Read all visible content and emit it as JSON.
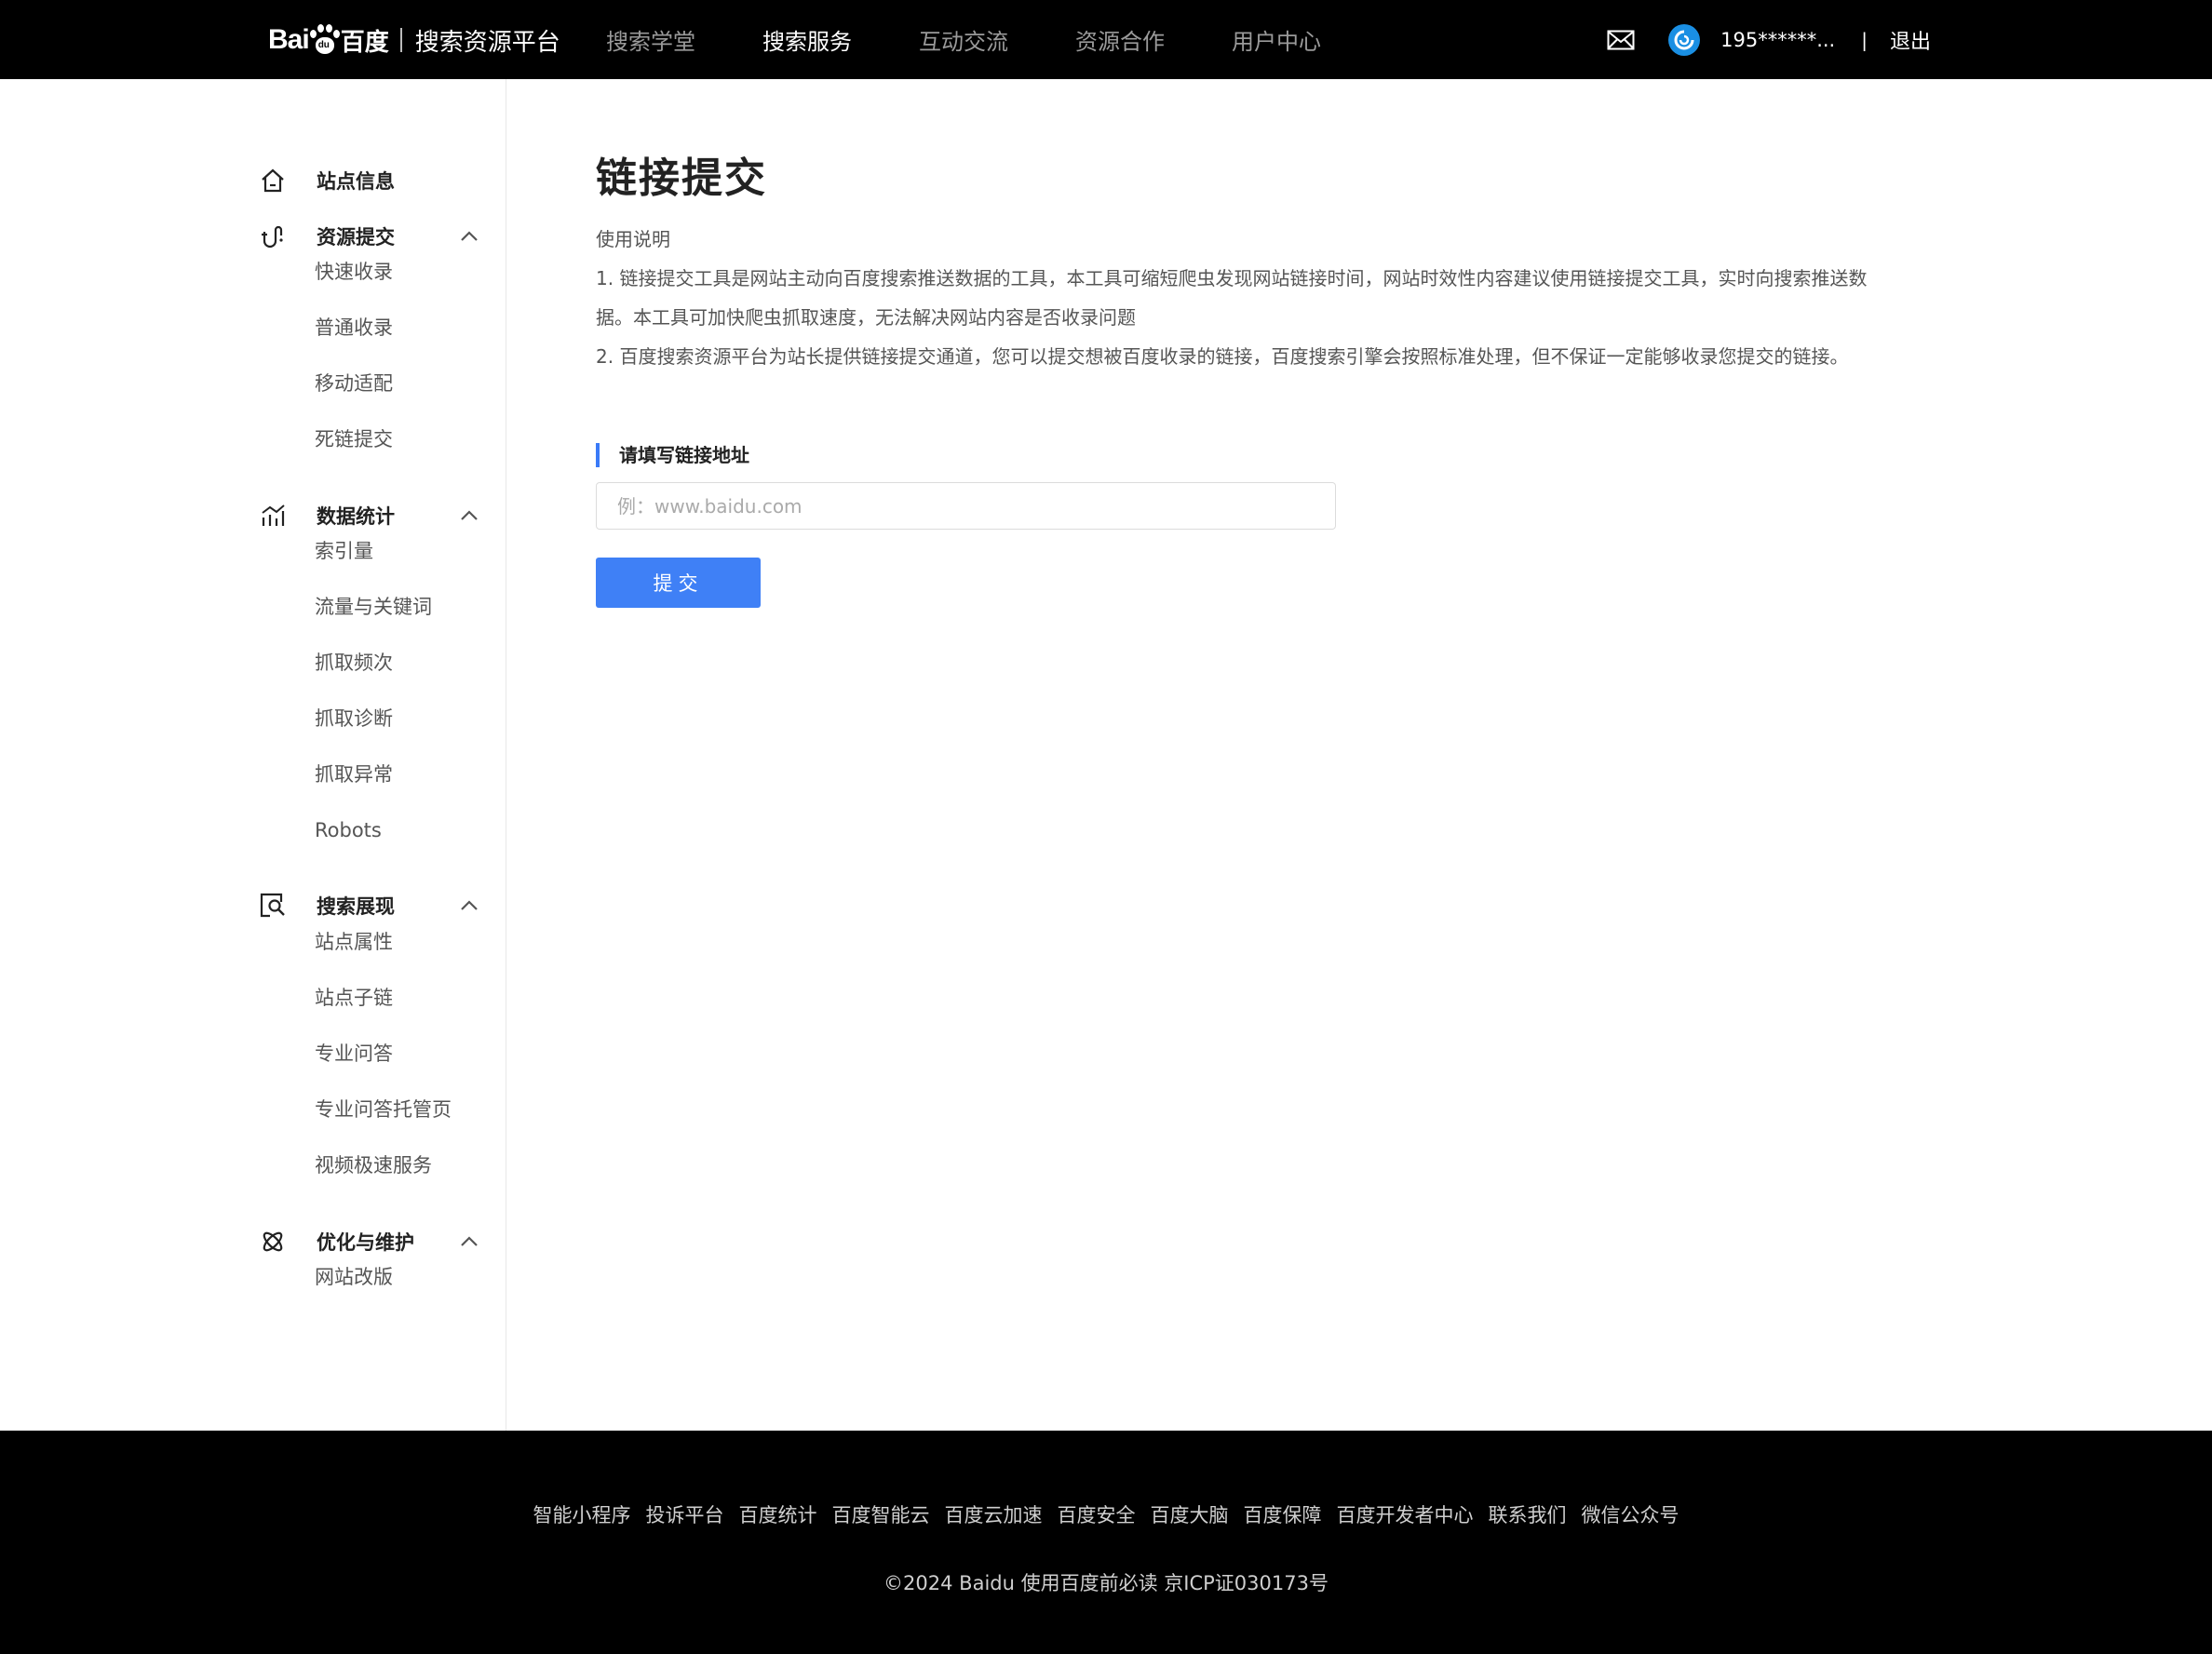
{
  "header": {
    "logo_text": "Bai",
    "logo_du": "du",
    "logo_cn": "百度",
    "platform_name": "搜索资源平台",
    "nav": [
      {
        "label": "搜索学堂",
        "active": false
      },
      {
        "label": "搜索服务",
        "active": true
      },
      {
        "label": "互动交流",
        "active": false
      },
      {
        "label": "资源合作",
        "active": false
      },
      {
        "label": "用户中心",
        "active": false
      }
    ],
    "user_name": "195******...",
    "divider": "|",
    "logout": "退出"
  },
  "sidebar": {
    "groups": [
      {
        "icon": "home-icon",
        "label": "站点信息",
        "items": []
      },
      {
        "icon": "resource-submit-icon",
        "label": "资源提交",
        "items": [
          "快速收录",
          "普通收录",
          "移动适配",
          "死链提交"
        ]
      },
      {
        "icon": "data-stats-icon",
        "label": "数据统计",
        "items": [
          "索引量",
          "流量与关键词",
          "抓取频次",
          "抓取诊断",
          "抓取异常",
          "Robots"
        ]
      },
      {
        "icon": "search-display-icon",
        "label": "搜索展现",
        "items": [
          "站点属性",
          "站点子链",
          "专业问答",
          "专业问答托管页",
          "视频极速服务"
        ]
      },
      {
        "icon": "optimize-icon",
        "label": "优化与维护",
        "items": [
          "网站改版"
        ]
      }
    ]
  },
  "main": {
    "title": "链接提交",
    "usage_title": "使用说明",
    "usage_lines": [
      "1. 链接提交工具是网站主动向百度搜索推送数据的工具，本工具可缩短爬虫发现网站链接时间，网站时效性内容建议使用链接提交工具，实时向搜索推送数",
      "据。本工具可加快爬虫抓取速度，无法解决网站内容是否收录问题",
      "2. 百度搜索资源平台为站长提供链接提交通道，您可以提交想被百度收录的链接，百度搜索引擎会按照标准处理，但不保证一定能够收录您提交的链接。"
    ],
    "section_label": "请填写链接地址",
    "input_placeholder": "例：www.baidu.com",
    "input_value": "",
    "submit_label": "提交"
  },
  "footer": {
    "links": [
      "智能小程序",
      "投诉平台",
      "百度统计",
      "百度智能云",
      "百度云加速",
      "百度安全",
      "百度大脑",
      "百度保障",
      "百度开发者中心",
      "联系我们",
      "微信公众号"
    ],
    "copyright": "©2024 Baidu 使用百度前必读 京ICP证030173号"
  },
  "colors": {
    "header_bg": "#000000",
    "accent": "#3f80f6",
    "nav_active": "#ffffff",
    "nav_inactive": "#9a9a9a"
  }
}
